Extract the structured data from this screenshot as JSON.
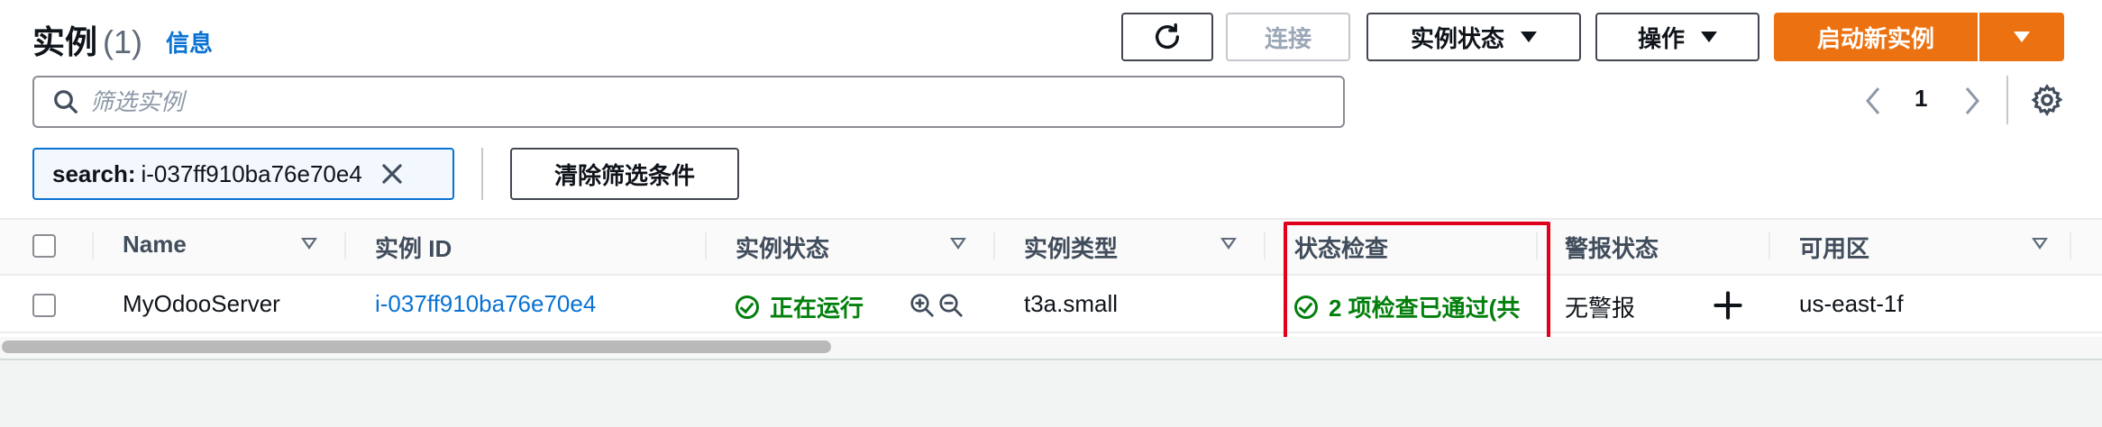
{
  "header": {
    "title": "实例",
    "count": "(1)",
    "info_link": "信息"
  },
  "toolbar": {
    "refresh_icon": "refresh-icon",
    "connect_label": "连接",
    "instance_state_label": "实例状态",
    "actions_label": "操作",
    "launch_label": "启动新实例"
  },
  "search": {
    "placeholder": "筛选实例",
    "value": ""
  },
  "filter_token": {
    "key": "search:",
    "value": "i-037ff910ba76e70e4"
  },
  "clear_filters_label": "清除筛选条件",
  "pagination": {
    "current_page": "1"
  },
  "table": {
    "columns": [
      "Name",
      "实例 ID",
      "实例状态",
      "实例类型",
      "状态检查",
      "警报状态",
      "可用区"
    ],
    "rows": [
      {
        "name": "MyOdooServer",
        "instance_id": "i-037ff910ba76e70e4",
        "state": "正在运行",
        "type": "t3a.small",
        "status_check": "2 项检查已通过(共",
        "alarm": "无警报",
        "az": "us-east-1f"
      }
    ]
  },
  "colors": {
    "primary": "#ec7211",
    "link": "#0972d3",
    "success": "#037f0c",
    "highlight": "#e0001b"
  }
}
